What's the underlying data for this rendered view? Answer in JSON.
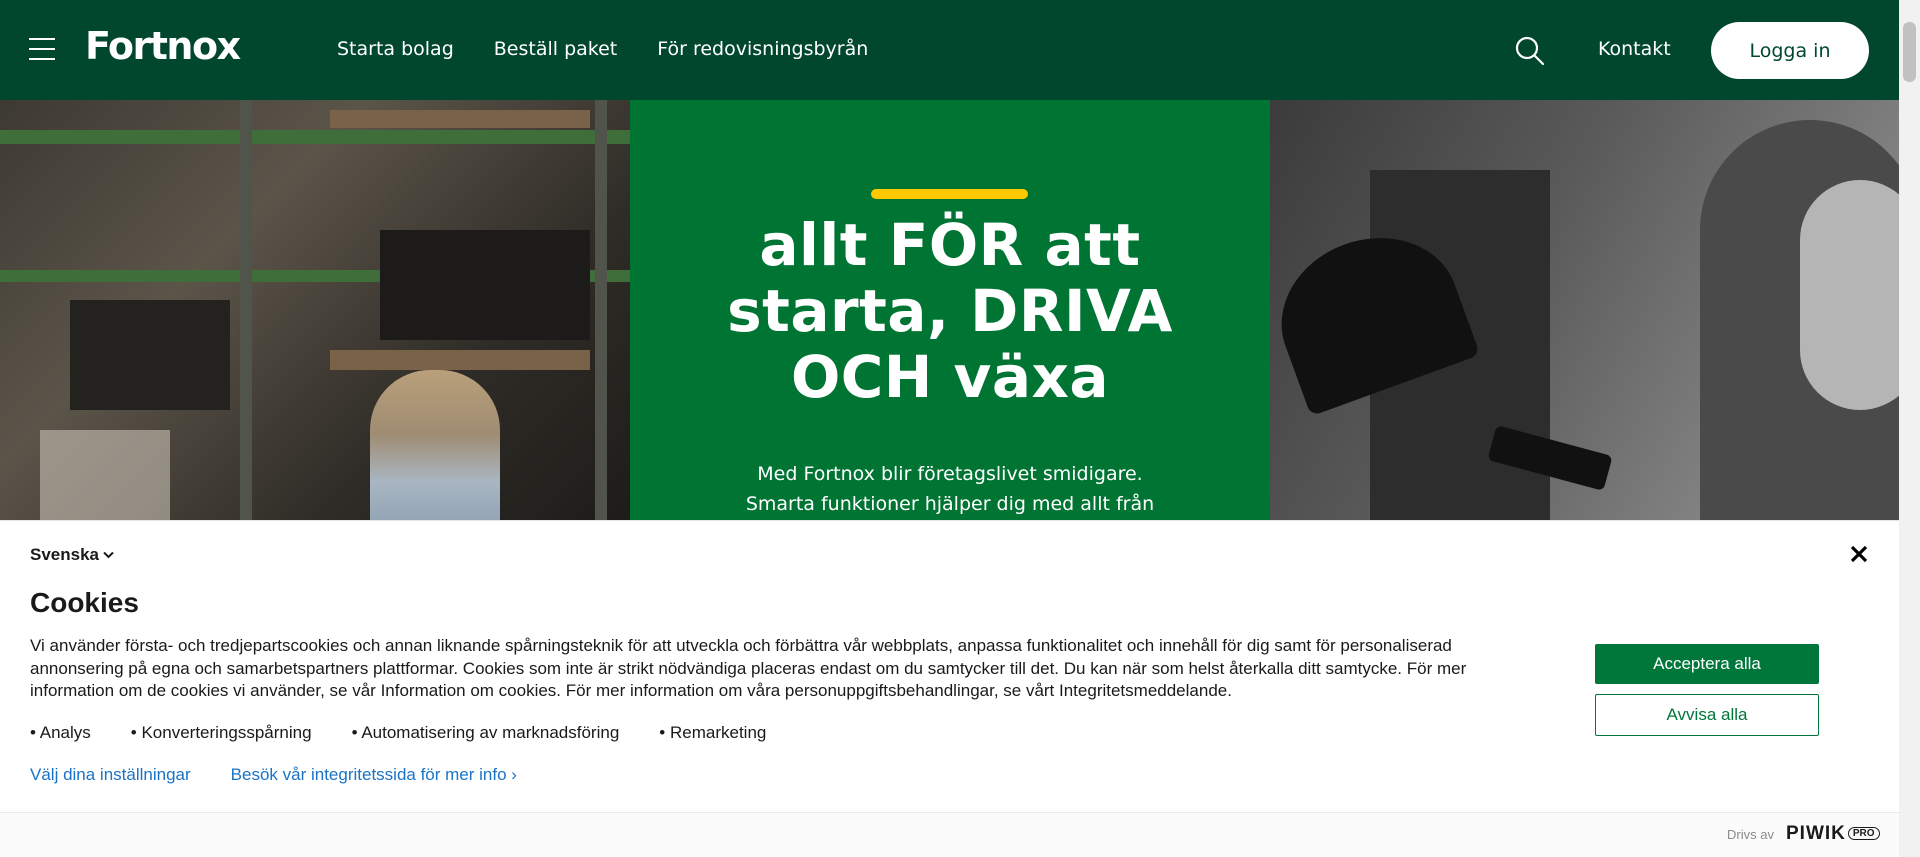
{
  "header": {
    "logo": "Fortnox",
    "nav": [
      {
        "label": "Starta bolag"
      },
      {
        "label": "Beställ paket"
      },
      {
        "label": "För redovisningsbyrån"
      }
    ],
    "contact_label": "Kontakt",
    "login_label": "Logga in",
    "colors": {
      "background": "#00472e",
      "text": "#ffffff"
    }
  },
  "hero": {
    "title_line1": "allt FÖR att",
    "title_line2": "starta, DRIVA",
    "title_line3": "OCH växa",
    "text_line1": "Med Fortnox blir företagslivet smidigare.",
    "text_line2": "Smarta funktioner hjälper dig med allt från",
    "colors": {
      "panel": "#007533",
      "accent": "#ffc800"
    }
  },
  "cookie_banner": {
    "language": "Svenska",
    "title": "Cookies",
    "text": "Vi använder första- och tredjepartscookies och annan liknande spårningsteknik för att utveckla och förbättra vår webbplats, anpassa funktionalitet och innehåll för dig samt för personaliserad annonsering på egna och samarbetspartners plattformar. Cookies som inte är strikt nödvändiga placeras endast om du samtycker till det. Du kan när som helst återkalla ditt samtycke. För mer information om de cookies vi använder, se vår Information om cookies. För mer information om våra personuppgiftsbehandlingar, se vårt Integritetsmeddelande.",
    "purposes": [
      "Analys",
      "Konverteringsspårning",
      "Automatisering av marknadsföring",
      "Remarketing"
    ],
    "settings_link": "Välj dina inställningar",
    "privacy_link": "Besök vår integritetssida för mer info ›",
    "accept_label": "Acceptera alla",
    "reject_label": "Avvisa alla",
    "colors": {
      "button": "#00773a",
      "link": "#1a73c6"
    }
  },
  "footer": {
    "powered_by": "Drivs av",
    "brand": "PIWIK",
    "brand_suffix": "PRO"
  }
}
